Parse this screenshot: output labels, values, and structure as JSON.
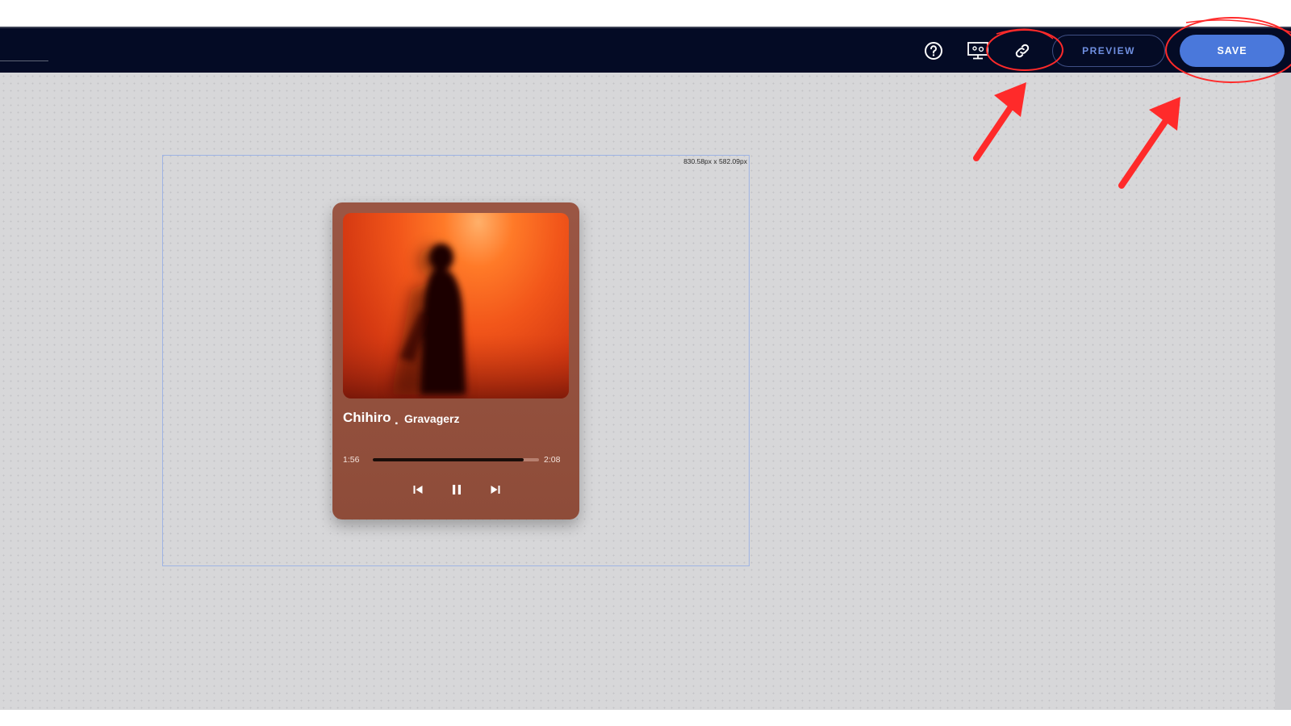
{
  "toolbar": {
    "help_icon": "help-circle-icon",
    "device_icon": "device-preview-icon",
    "link_icon": "link-icon",
    "preview_label": "PREVIEW",
    "save_label": "SAVE",
    "save_color": "#4a78db"
  },
  "canvas": {
    "size_label": "830.58px x 582.09px"
  },
  "player": {
    "title": "Chihiro",
    "separator": ".",
    "artist": "Gravagerz",
    "time_elapsed": "1:56",
    "time_total": "2:08",
    "progress": 0.91,
    "controls": [
      "skip-back-icon",
      "pause-icon",
      "skip-forward-icon"
    ],
    "card_color": "#954f3d"
  },
  "annotation_color": "#ff2a2a"
}
